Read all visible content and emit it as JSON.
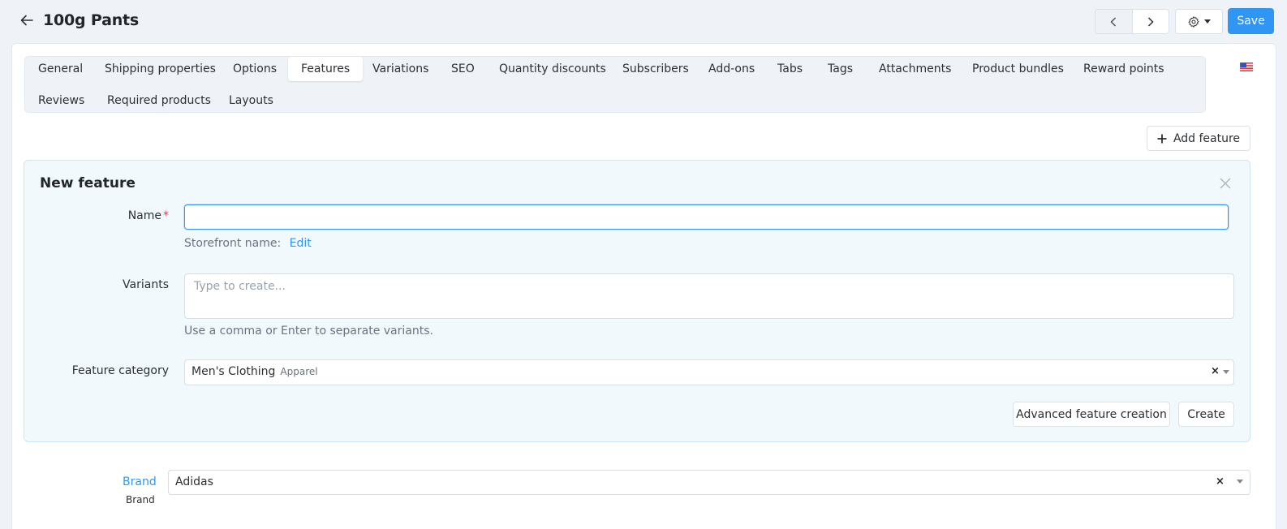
{
  "header": {
    "title": "100g Pants",
    "save_label": "Save",
    "icons": {
      "back": "arrow-left-icon",
      "prev": "chevron-left-icon",
      "next": "chevron-right-icon",
      "settings": "gear-icon"
    }
  },
  "tabs": [
    {
      "label": "General",
      "active": false
    },
    {
      "label": "Shipping properties",
      "active": false
    },
    {
      "label": "Options",
      "active": false
    },
    {
      "label": "Features",
      "active": true
    },
    {
      "label": "Variations",
      "active": false
    },
    {
      "label": "SEO",
      "active": false
    },
    {
      "label": "Quantity discounts",
      "active": false
    },
    {
      "label": "Subscribers",
      "active": false
    },
    {
      "label": "Add-ons",
      "active": false
    },
    {
      "label": "Tabs",
      "active": false
    },
    {
      "label": "Tags",
      "active": false
    },
    {
      "label": "Attachments",
      "active": false
    },
    {
      "label": "Product bundles",
      "active": false
    },
    {
      "label": "Reward points",
      "active": false
    },
    {
      "label": "Reviews",
      "active": false
    },
    {
      "label": "Required products",
      "active": false
    },
    {
      "label": "Layouts",
      "active": false
    }
  ],
  "language": "us-flag-icon",
  "toolbar": {
    "add_feature_label": "Add feature"
  },
  "new_feature": {
    "title": "New feature",
    "name_label": "Name",
    "name_required": "*",
    "name_value": "",
    "storefront_label": "Storefront name:",
    "storefront_edit": "Edit",
    "variants_label": "Variants",
    "variants_placeholder": "Type to create...",
    "variants_hint": "Use a comma or Enter to separate variants.",
    "category_label": "Feature category",
    "category_value": "Men's Clothing",
    "category_parent": "Apparel",
    "clear_symbol": "×",
    "advanced_label": "Advanced feature creation",
    "create_label": "Create"
  },
  "features": [
    {
      "name": "Brand",
      "type": "Brand",
      "value": "Adidas"
    }
  ],
  "colors": {
    "accent": "#3196f3",
    "panel_bg": "#f2f9fd",
    "page_bg": "#eff3f8",
    "required": "#e0414a"
  }
}
